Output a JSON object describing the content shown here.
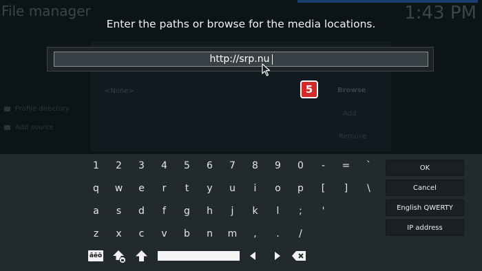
{
  "background": {
    "window_title": "File manager",
    "clock": "1:43 PM",
    "source_list_empty": "<None>",
    "browse_label": "Browse",
    "add_label": "Add",
    "remove_label": "Remove",
    "sidebar": [
      {
        "label": "Profile directory"
      },
      {
        "label": "Add source"
      }
    ]
  },
  "dialog": {
    "heading": "Enter the paths or browse for the media locations.",
    "input_value": "http://srp.nu",
    "badge": "5"
  },
  "keyboard": {
    "rows": [
      [
        "1",
        "2",
        "3",
        "4",
        "5",
        "6",
        "7",
        "8",
        "9",
        "0",
        "-",
        "=",
        "`"
      ],
      [
        "q",
        "w",
        "e",
        "r",
        "t",
        "y",
        "u",
        "i",
        "o",
        "p",
        "[",
        "]",
        "\\"
      ],
      [
        "a",
        "s",
        "d",
        "f",
        "g",
        "h",
        "j",
        "k",
        "l",
        ";",
        "'"
      ],
      [
        "z",
        "x",
        "c",
        "v",
        "b",
        "n",
        "m",
        ",",
        ".",
        "/"
      ]
    ],
    "side_buttons": {
      "ok": "OK",
      "cancel": "Cancel",
      "layout": "English QWERTY",
      "ip": "IP address"
    },
    "symbols_key": "âëö",
    "icons": {
      "symbols": "accented-symbols-icon",
      "shift_lock": "shift-lock-icon",
      "shift": "shift-arrow-icon",
      "left": "arrow-left-icon",
      "right": "arrow-right-icon",
      "backspace": "backspace-icon"
    }
  },
  "colors": {
    "background": "#0d1418",
    "keyboard_panel": "#232a2e",
    "input_field": "#394045",
    "badge": "#d42a2a"
  }
}
